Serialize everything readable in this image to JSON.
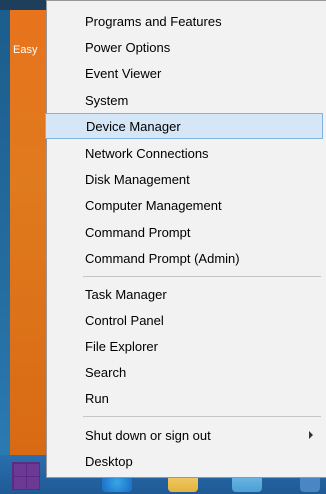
{
  "desktop": {
    "left_label": "Easy"
  },
  "menu": {
    "group1": [
      {
        "label": "Programs and Features"
      },
      {
        "label": "Power Options"
      },
      {
        "label": "Event Viewer"
      },
      {
        "label": "System"
      },
      {
        "label": "Device Manager",
        "highlighted": true
      },
      {
        "label": "Network Connections"
      },
      {
        "label": "Disk Management"
      },
      {
        "label": "Computer Management"
      },
      {
        "label": "Command Prompt"
      },
      {
        "label": "Command Prompt (Admin)"
      }
    ],
    "group2": [
      {
        "label": "Task Manager"
      },
      {
        "label": "Control Panel"
      },
      {
        "label": "File Explorer"
      },
      {
        "label": "Search"
      },
      {
        "label": "Run"
      }
    ],
    "group3": [
      {
        "label": "Shut down or sign out",
        "has_submenu": true
      },
      {
        "label": "Desktop"
      }
    ]
  },
  "colors": {
    "highlight_bg": "#d5e6f7",
    "highlight_border": "#7fb4e0",
    "menu_bg": "#f2f2f2",
    "taskbar": "#1f5a95"
  }
}
